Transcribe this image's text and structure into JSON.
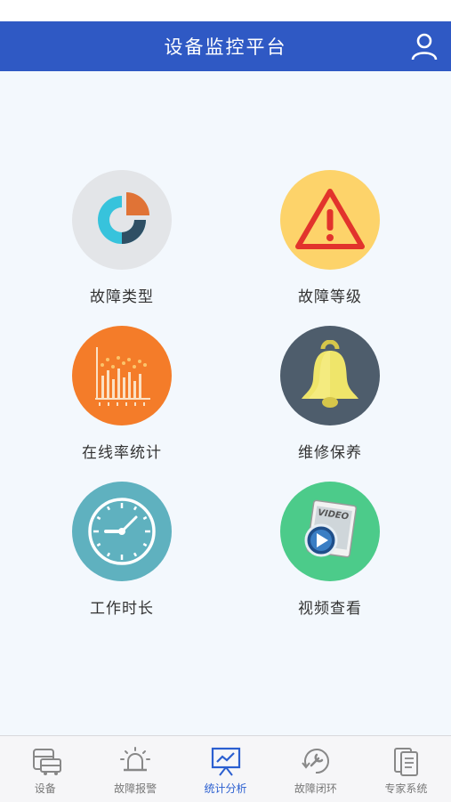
{
  "header": {
    "title": "设备监控平台"
  },
  "tiles": [
    {
      "label": "故障类型",
      "icon": "pie-chart-icon",
      "bg": "#e3e5e8"
    },
    {
      "label": "故障等级",
      "icon": "warning-triangle-icon",
      "bg": "#fdd36a"
    },
    {
      "label": "在线率统计",
      "icon": "bar-chart-icon",
      "bg": "#f47c29"
    },
    {
      "label": "维修保养",
      "icon": "bell-icon",
      "bg": "#4e5d6c"
    },
    {
      "label": "工作时长",
      "icon": "clock-icon",
      "bg": "#5fb1bf"
    },
    {
      "label": "视频查看",
      "icon": "video-icon",
      "bg": "#4ccb8a",
      "icon_text": "VIDEO"
    }
  ],
  "tabs": [
    {
      "label": "设备",
      "icon": "vehicle-icon"
    },
    {
      "label": "故障报警",
      "icon": "siren-icon"
    },
    {
      "label": "统计分析",
      "icon": "presentation-chart-icon",
      "active": true
    },
    {
      "label": "故障闭环",
      "icon": "wrench-cycle-icon"
    },
    {
      "label": "专家系统",
      "icon": "book-icon"
    }
  ],
  "colors": {
    "primary": "#2f59c4",
    "active_tab": "#2b5fd0",
    "background": "#f3f8fd"
  }
}
